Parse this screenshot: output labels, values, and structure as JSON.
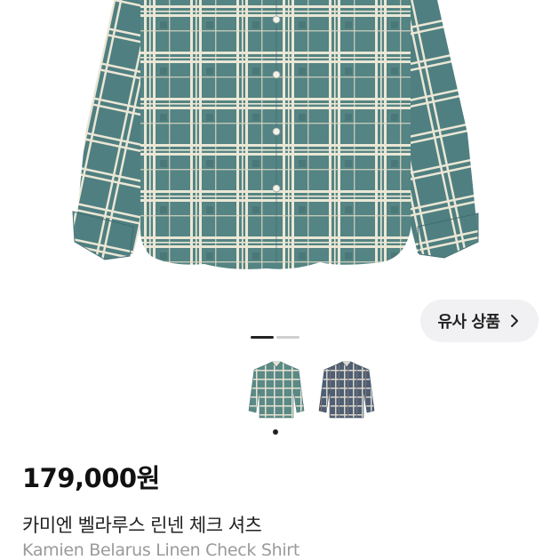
{
  "product": {
    "price": "179,000원",
    "name_ko": "카미엔 벨라루스 린넨 체크 셔츠",
    "name_en": "Kamien Belarus Linen Check Shirt"
  },
  "similar": {
    "label": "유사 상품",
    "icon": "chevron-right-icon"
  },
  "gallery": {
    "slide_count": 2,
    "active_slide": 1,
    "thumbnails": [
      {
        "variant": "green-check-shirt",
        "color": "#5b8a86"
      },
      {
        "variant": "navy-check-shirt",
        "color": "#4c5f74"
      }
    ]
  },
  "colors": {
    "shirt_base": "#4f7f80",
    "shirt_check": "#e7e3d2",
    "button_bg": "#f1f1f3"
  }
}
